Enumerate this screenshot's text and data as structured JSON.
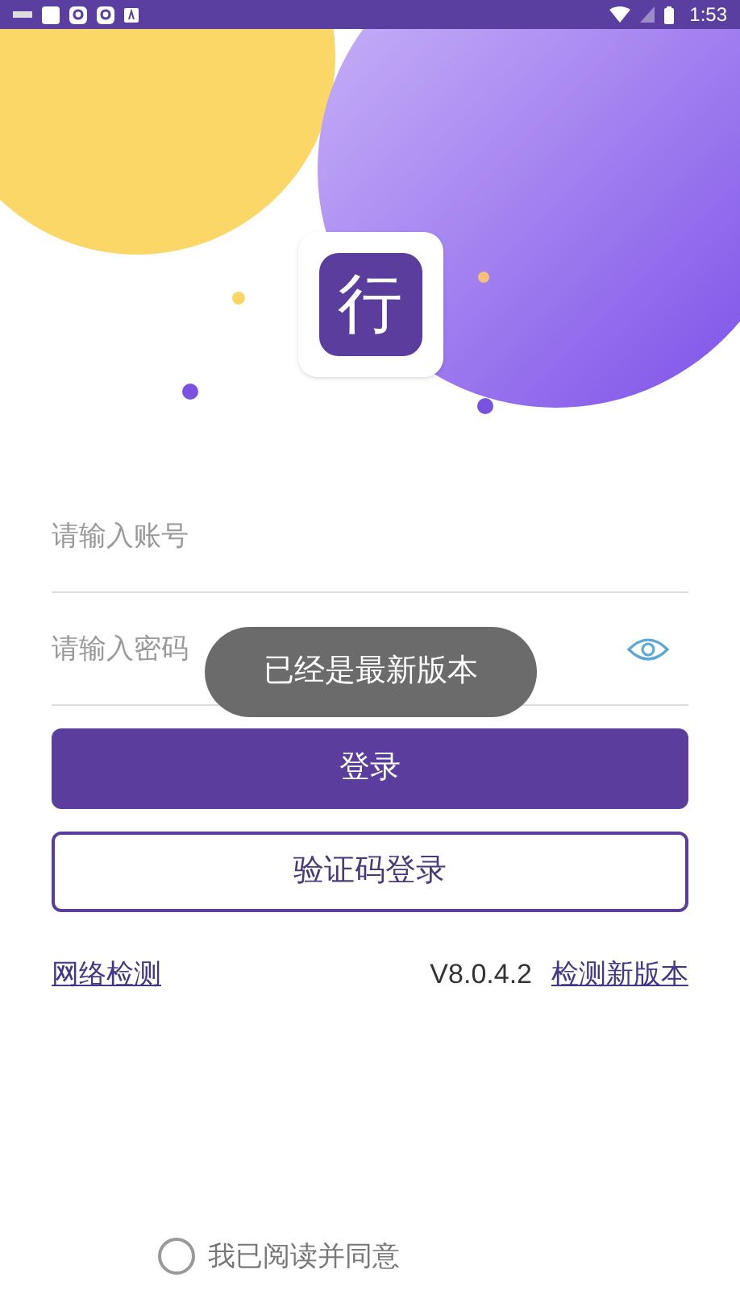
{
  "status_bar": {
    "time": "1:53"
  },
  "logo": {
    "text": "行"
  },
  "fields": [
    {
      "kind": "account",
      "placeholder": "请输入账号"
    },
    {
      "kind": "password",
      "placeholder": "请输入密码"
    }
  ],
  "toast": {
    "text": "已经是最新版本"
  },
  "buttons": [
    {
      "kind": "primary",
      "label": "登录"
    },
    {
      "kind": "outline",
      "label": "验证码登录"
    }
  ],
  "links": {
    "network": "网络检测",
    "version": "V8.0.4.2",
    "update": "检测新版本"
  },
  "agreement": {
    "checked": false,
    "text": "我已阅读并同意"
  }
}
